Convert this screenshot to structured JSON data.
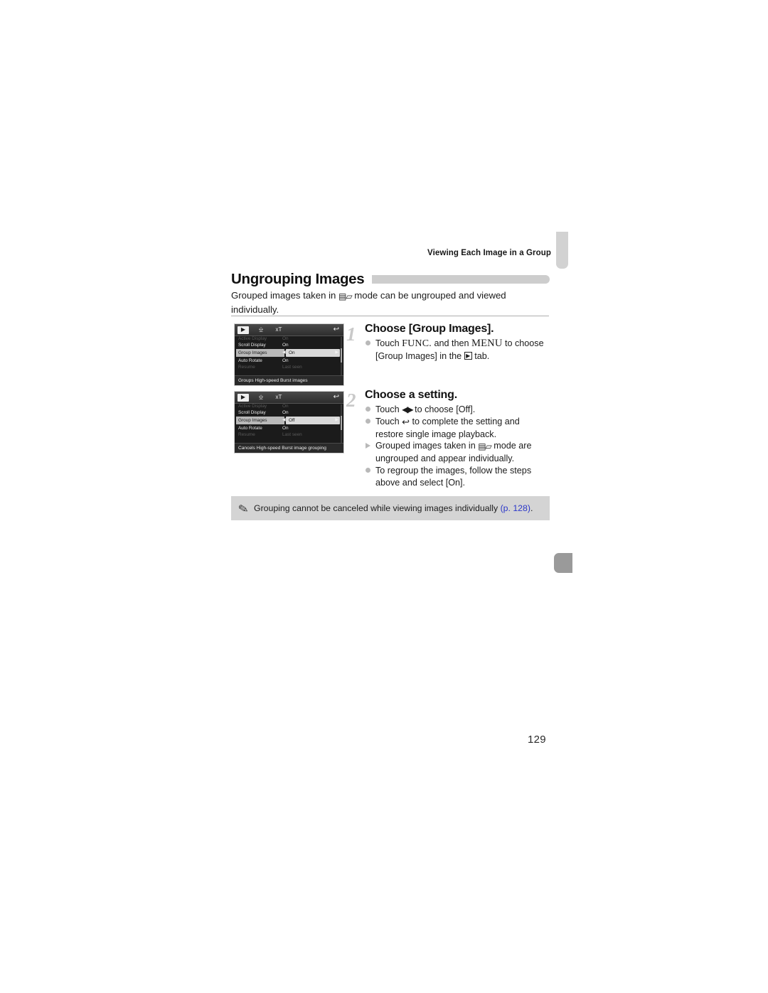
{
  "page": {
    "running_head": "Viewing Each Image in a Group",
    "folio": "129",
    "section_title": "Ungrouping Images",
    "intro_a": "Grouped images taken in",
    "intro_icon": "high-speed-burst-icon",
    "intro_b": "mode can be ungrouped and viewed",
    "intro_c": "individually."
  },
  "steps": [
    {
      "number": "1",
      "title": "Choose [Group Images].",
      "bullets": [
        {
          "marker": "dot",
          "a": "Touch",
          "glyph1": "FUNC.",
          "b": "and then",
          "glyph2": "MENU",
          "c": "to choose",
          "d": "[Group Images] in the",
          "glyph3": "playback-tab-icon",
          "e": "tab."
        }
      ]
    },
    {
      "number": "2",
      "title": "Choose a setting.",
      "bullets": [
        {
          "marker": "dot",
          "a": "Touch",
          "glyph1": "◀▶",
          "b": "to choose [Off]."
        },
        {
          "marker": "dot",
          "a": "Touch",
          "glyph1": "↩",
          "b": "to complete the setting and",
          "c": "restore single image playback."
        },
        {
          "marker": "triangle",
          "a": "Grouped images taken in",
          "glyph1": "high-speed-burst-icon",
          "b": "mode are",
          "c": "ungrouped and appear individually."
        },
        {
          "marker": "dot",
          "a": "To regroup the images, follow the steps",
          "b": "above and select [On]."
        }
      ]
    }
  ],
  "lcd_shots": [
    {
      "id": "lcd-group-images-on",
      "tabs": [
        "playback-tab-icon",
        "print-tab-icon",
        "settings-tab-icon"
      ],
      "selected_tab": "playback-tab-icon",
      "back_icon": "return-arrow-icon",
      "rows": [
        {
          "label": "Active Display",
          "value": "On",
          "state": "clipped"
        },
        {
          "label": "Scroll Display",
          "value": "On",
          "state": "normal"
        },
        {
          "label": "Group Images",
          "value": "On",
          "state": "selected"
        },
        {
          "label": "Auto Rotate",
          "value": "On",
          "state": "normal"
        },
        {
          "label": "Resume",
          "value": "Last seen",
          "state": "clipped"
        }
      ],
      "hint": "Groups High-speed Burst images"
    },
    {
      "id": "lcd-group-images-off",
      "tabs": [
        "playback-tab-icon",
        "print-tab-icon",
        "settings-tab-icon"
      ],
      "selected_tab": "playback-tab-icon",
      "back_icon": "return-arrow-icon",
      "rows": [
        {
          "label": "Active Display",
          "value": "On",
          "state": "clipped"
        },
        {
          "label": "Scroll Display",
          "value": "On",
          "state": "normal"
        },
        {
          "label": "Group Images",
          "value": "Off",
          "state": "selected"
        },
        {
          "label": "Auto Rotate",
          "value": "On",
          "state": "normal"
        },
        {
          "label": "Resume",
          "value": "Last seen",
          "state": "clipped"
        }
      ],
      "hint": "Cancels High-speed Burst image grouping"
    }
  ],
  "note": {
    "icon": "pencil-icon",
    "text": "Grouping cannot be canceled while viewing images individually",
    "ref": "(p. 128)",
    "tail": "."
  },
  "colors": {
    "tab_inactive": "#d2d2d2",
    "tab_active": "#9a9a9a",
    "head_rule": "#cdcdcd",
    "note_bg": "#d4d4d4",
    "link": "#2b37c9",
    "step_number": "#c9c9c9"
  }
}
